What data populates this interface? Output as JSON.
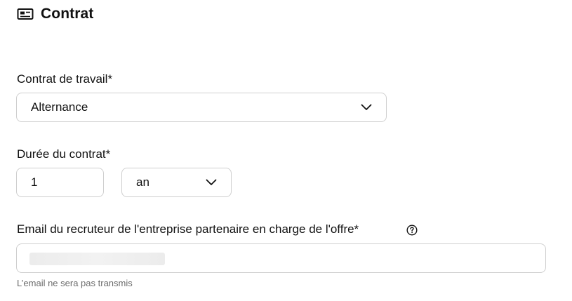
{
  "section": {
    "title": "Contrat",
    "icon": "id-card-icon"
  },
  "contract_type": {
    "label": "Contrat de travail*",
    "value": "Alternance",
    "icon": "chevron-down-icon"
  },
  "duration": {
    "label": "Durée du contrat*",
    "amount": "1",
    "unit": "an",
    "icon": "chevron-down-icon"
  },
  "recruiter_email": {
    "label": "Email du recruteur de l'entreprise partenaire en charge de l'offre*",
    "help_icon": "question-circle-icon",
    "hint": "L’email ne sera pas transmis"
  }
}
